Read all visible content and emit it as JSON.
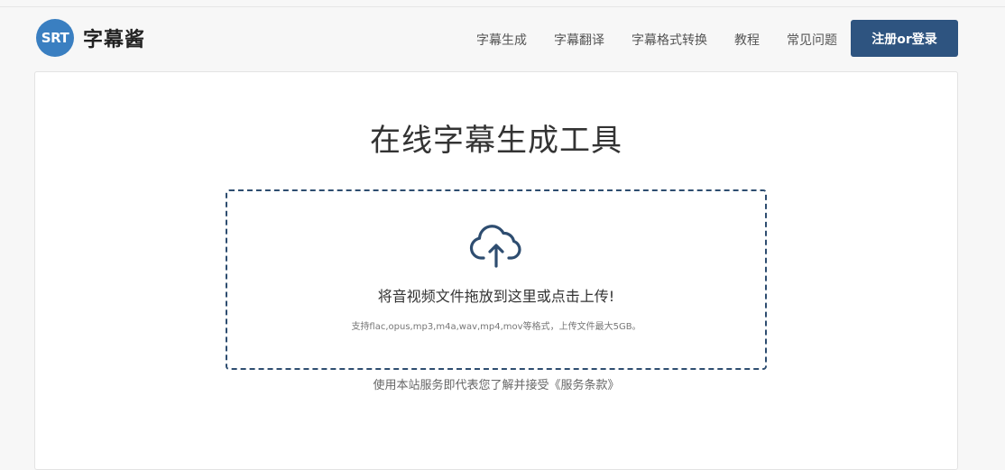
{
  "brand": {
    "badge": "SRT",
    "name": "字幕酱"
  },
  "nav": {
    "items": [
      "字幕生成",
      "字幕翻译",
      "字幕格式转换",
      "教程",
      "常见问题"
    ],
    "login_label": "注册or登录"
  },
  "main": {
    "title": "在线字幕生成工具",
    "dropzone": {
      "icon": "cloud-upload-icon",
      "prompt": "将音视频文件拖放到这里或点击上传!",
      "hint": "支持flac,opus,mp3,m4a,wav,mp4,mov等格式，上传文件最大5GB。"
    },
    "terms_prefix": "使用本站服务即代表您了解并接受",
    "terms_link": "《服务条款》"
  },
  "colors": {
    "accent": "#2e5480",
    "badge": "#3a7fc1",
    "dropzone_border": "#2e4d70"
  }
}
